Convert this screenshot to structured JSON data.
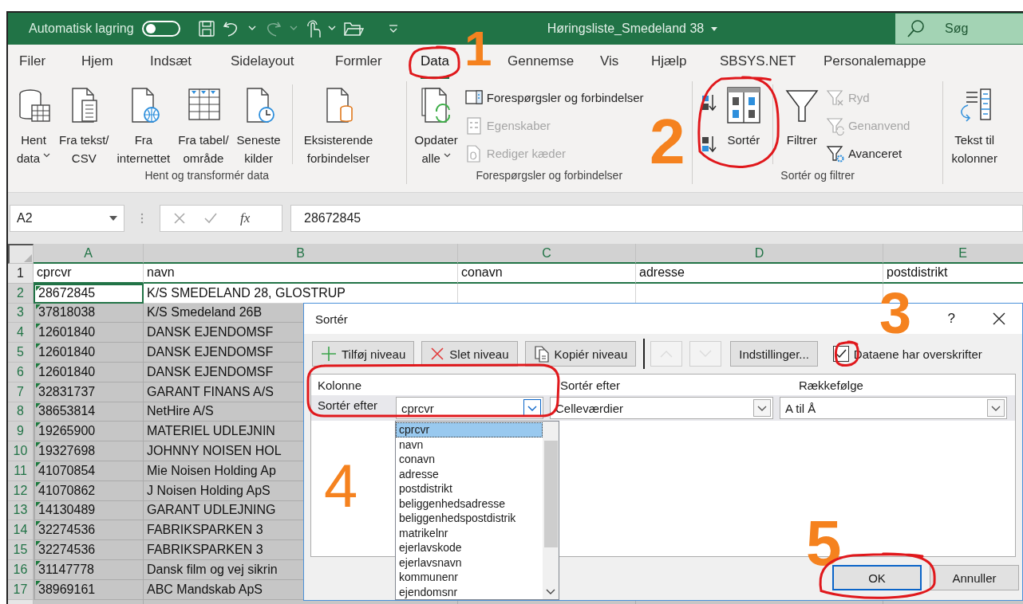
{
  "title_bar": {
    "autosave_label": "Automatisk lagring",
    "autosave_on": false,
    "document_title": "Høringsliste_Smedeland 38",
    "search_placeholder": "Søg"
  },
  "ribbon_tabs": [
    {
      "label": "Filer",
      "selected": false
    },
    {
      "label": "Hjem",
      "selected": false
    },
    {
      "label": "Indsæt",
      "selected": false
    },
    {
      "label": "Sidelayout",
      "selected": false
    },
    {
      "label": "Formler",
      "selected": false
    },
    {
      "label": "Data",
      "selected": true
    },
    {
      "label": "Gennemse",
      "selected": false
    },
    {
      "label": "Vis",
      "selected": false
    },
    {
      "label": "Hjælp",
      "selected": false
    },
    {
      "label": "SBSYS.NET",
      "selected": false
    },
    {
      "label": "Personalemappe",
      "selected": false
    }
  ],
  "ribbon_groups": [
    {
      "label": "Hent og transformér data",
      "items": [
        {
          "kind": "large",
          "lines": [
            "Hent",
            "data"
          ],
          "dropdown": true
        },
        {
          "kind": "large",
          "lines": [
            "Fra tekst/",
            "CSV"
          ],
          "dropdown": false
        },
        {
          "kind": "large",
          "lines": [
            "Fra",
            "internettet"
          ],
          "dropdown": false
        },
        {
          "kind": "large",
          "lines": [
            "Fra tabel/",
            "område"
          ],
          "dropdown": false
        },
        {
          "kind": "large",
          "lines": [
            "Seneste",
            "kilder"
          ],
          "dropdown": false
        },
        {
          "kind": "separator"
        },
        {
          "kind": "large",
          "lines": [
            "Eksisterende",
            "forbindelser"
          ],
          "dropdown": false
        }
      ]
    },
    {
      "label": "Forespørgsler og forbindelser",
      "items": [
        {
          "kind": "large",
          "lines": [
            "Opdater",
            "alle"
          ],
          "dropdown": true
        },
        {
          "kind": "small",
          "label": "Forespørgsler og forbindelser",
          "disabled": false
        },
        {
          "kind": "small",
          "label": "Egenskaber",
          "disabled": true
        },
        {
          "kind": "small",
          "label": "Rediger kæder",
          "disabled": true
        }
      ]
    },
    {
      "label": "Sortér og filtrer",
      "items": [
        {
          "kind": "icon"
        },
        {
          "kind": "icon"
        },
        {
          "kind": "large",
          "lines": [
            "Sortér"
          ],
          "dropdown": false
        },
        {
          "kind": "separator"
        },
        {
          "kind": "large",
          "lines": [
            "Filtrer"
          ],
          "dropdown": false
        },
        {
          "kind": "small",
          "label": "Ryd",
          "disabled": true
        },
        {
          "kind": "small",
          "label": "Genanvend",
          "disabled": true
        },
        {
          "kind": "small",
          "label": "Avanceret",
          "disabled": false
        }
      ]
    },
    {
      "items": [
        {
          "kind": "large",
          "lines": [
            "Tekst til",
            "kolonner"
          ],
          "dropdown": false
        }
      ]
    }
  ],
  "formula_bar": {
    "name_box": "A2",
    "function_label": "fx",
    "formula": "28672845"
  },
  "grid": {
    "columns": [
      {
        "letter": "A",
        "selected": true
      },
      {
        "letter": "B",
        "selected": true
      },
      {
        "letter": "C",
        "selected": true
      },
      {
        "letter": "D",
        "selected": true
      },
      {
        "letter": "E",
        "selected": true
      }
    ],
    "rows": [
      {
        "number": "1",
        "selected": false,
        "active": false,
        "warning": false,
        "cells": [
          "cprcvr",
          "navn",
          "conavn",
          "adresse",
          "postdistrikt"
        ]
      },
      {
        "number": "2",
        "selected": true,
        "active": true,
        "warning": true,
        "cells": [
          "28672845",
          "K/S SMEDELAND 28, GLOSTRUP"
        ]
      },
      {
        "number": "3",
        "selected": true,
        "active": false,
        "warning": true,
        "cells": [
          "37818038",
          "K/S Smedeland 26B"
        ]
      },
      {
        "number": "4",
        "selected": true,
        "active": false,
        "warning": true,
        "cells": [
          "12601840",
          "DANSK EJENDOMSF"
        ]
      },
      {
        "number": "5",
        "selected": true,
        "active": false,
        "warning": true,
        "cells": [
          "12601840",
          "DANSK EJENDOMSF"
        ]
      },
      {
        "number": "6",
        "selected": true,
        "active": false,
        "warning": true,
        "cells": [
          "12601840",
          "DANSK EJENDOMSF"
        ]
      },
      {
        "number": "7",
        "selected": true,
        "active": false,
        "warning": true,
        "cells": [
          "32831737",
          "GARANT FINANS A/S"
        ]
      },
      {
        "number": "8",
        "selected": true,
        "active": false,
        "warning": true,
        "cells": [
          "38653814",
          "NetHire A/S"
        ]
      },
      {
        "number": "9",
        "selected": true,
        "active": false,
        "warning": true,
        "cells": [
          "19265900",
          "MATERIEL UDLEJNIN"
        ]
      },
      {
        "number": "10",
        "selected": true,
        "active": false,
        "warning": true,
        "cells": [
          "19327698",
          "JOHNNY NOISEN HOL"
        ]
      },
      {
        "number": "11",
        "selected": true,
        "active": false,
        "warning": true,
        "cells": [
          "41070854",
          "Mie Noisen Holding Ap"
        ]
      },
      {
        "number": "12",
        "selected": true,
        "active": false,
        "warning": true,
        "cells": [
          "41070862",
          "J Noisen Holding ApS"
        ]
      },
      {
        "number": "13",
        "selected": true,
        "active": false,
        "warning": true,
        "cells": [
          "14130489",
          "GARANT UDLEJNING"
        ]
      },
      {
        "number": "14",
        "selected": true,
        "active": false,
        "warning": true,
        "cells": [
          "32274536",
          "FABRIKSPARKEN 3"
        ]
      },
      {
        "number": "15",
        "selected": true,
        "active": false,
        "warning": true,
        "cells": [
          "32274536",
          "FABRIKSPARKEN 3"
        ]
      },
      {
        "number": "16",
        "selected": true,
        "active": false,
        "warning": true,
        "cells": [
          "31147778",
          "Dansk film og vej sikrin"
        ]
      },
      {
        "number": "17",
        "selected": true,
        "active": false,
        "warning": true,
        "cells": [
          "38969161",
          "ABC Mandskab ApS"
        ]
      }
    ]
  },
  "dialog": {
    "title": "Sortér",
    "help": "?",
    "toolbar": [
      {
        "kind": "add",
        "label": "Tilføj niveau",
        "disabled": false
      },
      {
        "kind": "delete",
        "label": "Slet niveau",
        "disabled": false
      },
      {
        "kind": "copy",
        "label": "Kopiér niveau",
        "disabled": false
      },
      {
        "kind": "move-up",
        "disabled": true
      },
      {
        "kind": "move-down",
        "disabled": true
      },
      {
        "kind": "options",
        "label": "Indstillinger...",
        "disabled": false
      }
    ],
    "headers_checkbox": {
      "label": "Dataene har overskrifter",
      "checked": true
    },
    "columns": [
      "Kolonne",
      "Sortér efter",
      "Rækkefølge"
    ],
    "level": {
      "label": "Sortér efter",
      "column": "cprcvr",
      "sort_on": "Celleværdier",
      "order": "A til Å"
    },
    "column_options": [
      {
        "label": "cprcvr",
        "selected": true
      },
      {
        "label": "navn",
        "selected": false
      },
      {
        "label": "conavn",
        "selected": false
      },
      {
        "label": "adresse",
        "selected": false
      },
      {
        "label": "postdistrikt",
        "selected": false
      },
      {
        "label": "beliggenhedsadresse",
        "selected": false
      },
      {
        "label": "beliggenhedspostdistrik",
        "selected": false
      },
      {
        "label": "matrikelnr",
        "selected": false
      },
      {
        "label": "ejerlavskode",
        "selected": false
      },
      {
        "label": "ejerlavsnavn",
        "selected": false
      },
      {
        "label": "kommunenr",
        "selected": false
      },
      {
        "label": "ejendomsnr",
        "selected": false
      }
    ],
    "buttons": [
      {
        "label": "OK",
        "default": true
      },
      {
        "label": "Annuller",
        "default": false
      }
    ]
  },
  "annotations": [
    {
      "number": "1"
    },
    {
      "number": "2"
    },
    {
      "number": "3"
    },
    {
      "number": "4"
    },
    {
      "number": "5"
    }
  ]
}
